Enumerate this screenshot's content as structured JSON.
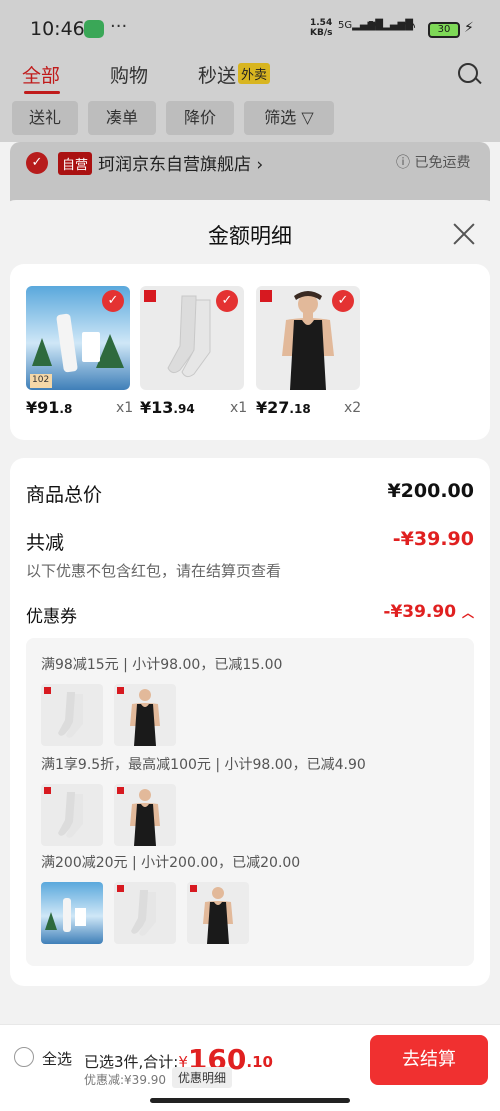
{
  "status": {
    "time": "10:46",
    "dots": "···",
    "speed_top": "1.54",
    "speed_bottom": "KB/s",
    "sig1": "5G",
    "sig2": "5G",
    "battery": "30"
  },
  "bg": {
    "tabs": [
      "全部",
      "购物",
      "秒送"
    ],
    "tab_badge": "外卖",
    "filters": [
      "送礼",
      "凑单",
      "降价",
      "筛选"
    ],
    "store_badge": "自营",
    "store_name": "珂润京东自营旗舰店",
    "free_shipping": "已免运费"
  },
  "sheet": {
    "title": "金额明细",
    "products": [
      {
        "price_int": "¥91",
        "price_dec": ".8",
        "qty": "x1",
        "img_label": "102"
      },
      {
        "price_int": "¥13",
        "price_dec": ".94",
        "qty": "x1"
      },
      {
        "price_int": "¥27",
        "price_dec": ".18",
        "qty": "x2"
      }
    ],
    "total_label": "商品总价",
    "total_value": "¥200.00",
    "reduce_label": "共减",
    "reduce_value": "-¥39.90",
    "reduce_note": "以下优惠不包含红包，请在结算页查看",
    "coupon_label": "优惠券",
    "coupon_value": "-¥39.90",
    "coupon_lines": [
      "满98减15元 | 小计98.00，已减15.00",
      "满1享9.5折，最高减100元 | 小计98.00，已减4.90",
      "满200减20元 | 小计200.00，已减20.00"
    ]
  },
  "bottom": {
    "select_all": "全选",
    "summary_prefix": "已选3件,合计:",
    "currency": "¥",
    "total_int": "160",
    "total_dec": ".10",
    "discount": "优惠减:¥39.90",
    "detail": "优惠明细",
    "checkout": "去结算"
  },
  "colors": {
    "accent": "#e02020",
    "checkout_bg": "#f03030"
  }
}
